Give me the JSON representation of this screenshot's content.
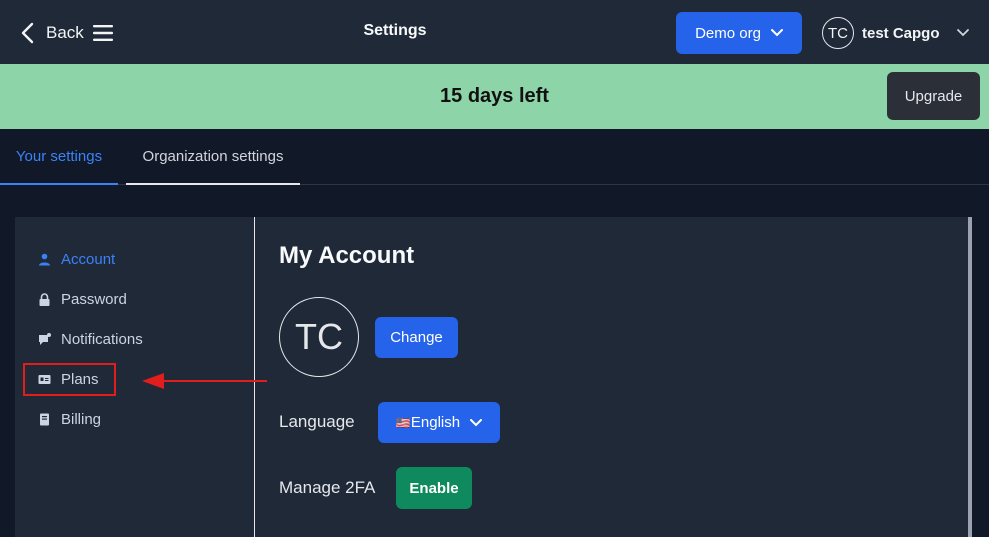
{
  "topbar": {
    "back_label": "Back",
    "title": "Settings",
    "org_label": "Demo org",
    "user_initials": "TC",
    "user_name": "test Capgo"
  },
  "banner": {
    "text": "15 days left",
    "upgrade_label": "Upgrade"
  },
  "tabs": [
    {
      "label": "Your settings",
      "active": true
    },
    {
      "label": "Organization settings",
      "active": false
    }
  ],
  "sidebar": {
    "items": [
      {
        "label": "Account",
        "icon": "user-icon",
        "active": true
      },
      {
        "label": "Password",
        "icon": "lock-icon",
        "active": false
      },
      {
        "label": "Notifications",
        "icon": "bell-icon",
        "active": false
      },
      {
        "label": "Plans",
        "icon": "id-card-icon",
        "active": false
      },
      {
        "label": "Billing",
        "icon": "receipt-icon",
        "active": false
      }
    ]
  },
  "account": {
    "heading": "My Account",
    "avatar_initials": "TC",
    "change_label": "Change",
    "language_label": "Language",
    "language_flag": "🇺🇸",
    "language_value": "English",
    "twofa_label": "Manage 2FA",
    "twofa_button": "Enable"
  },
  "colors": {
    "accent": "#2563eb",
    "banner": "#8dd4a8",
    "highlight": "#e11d1d",
    "success": "#0f8a5f"
  }
}
